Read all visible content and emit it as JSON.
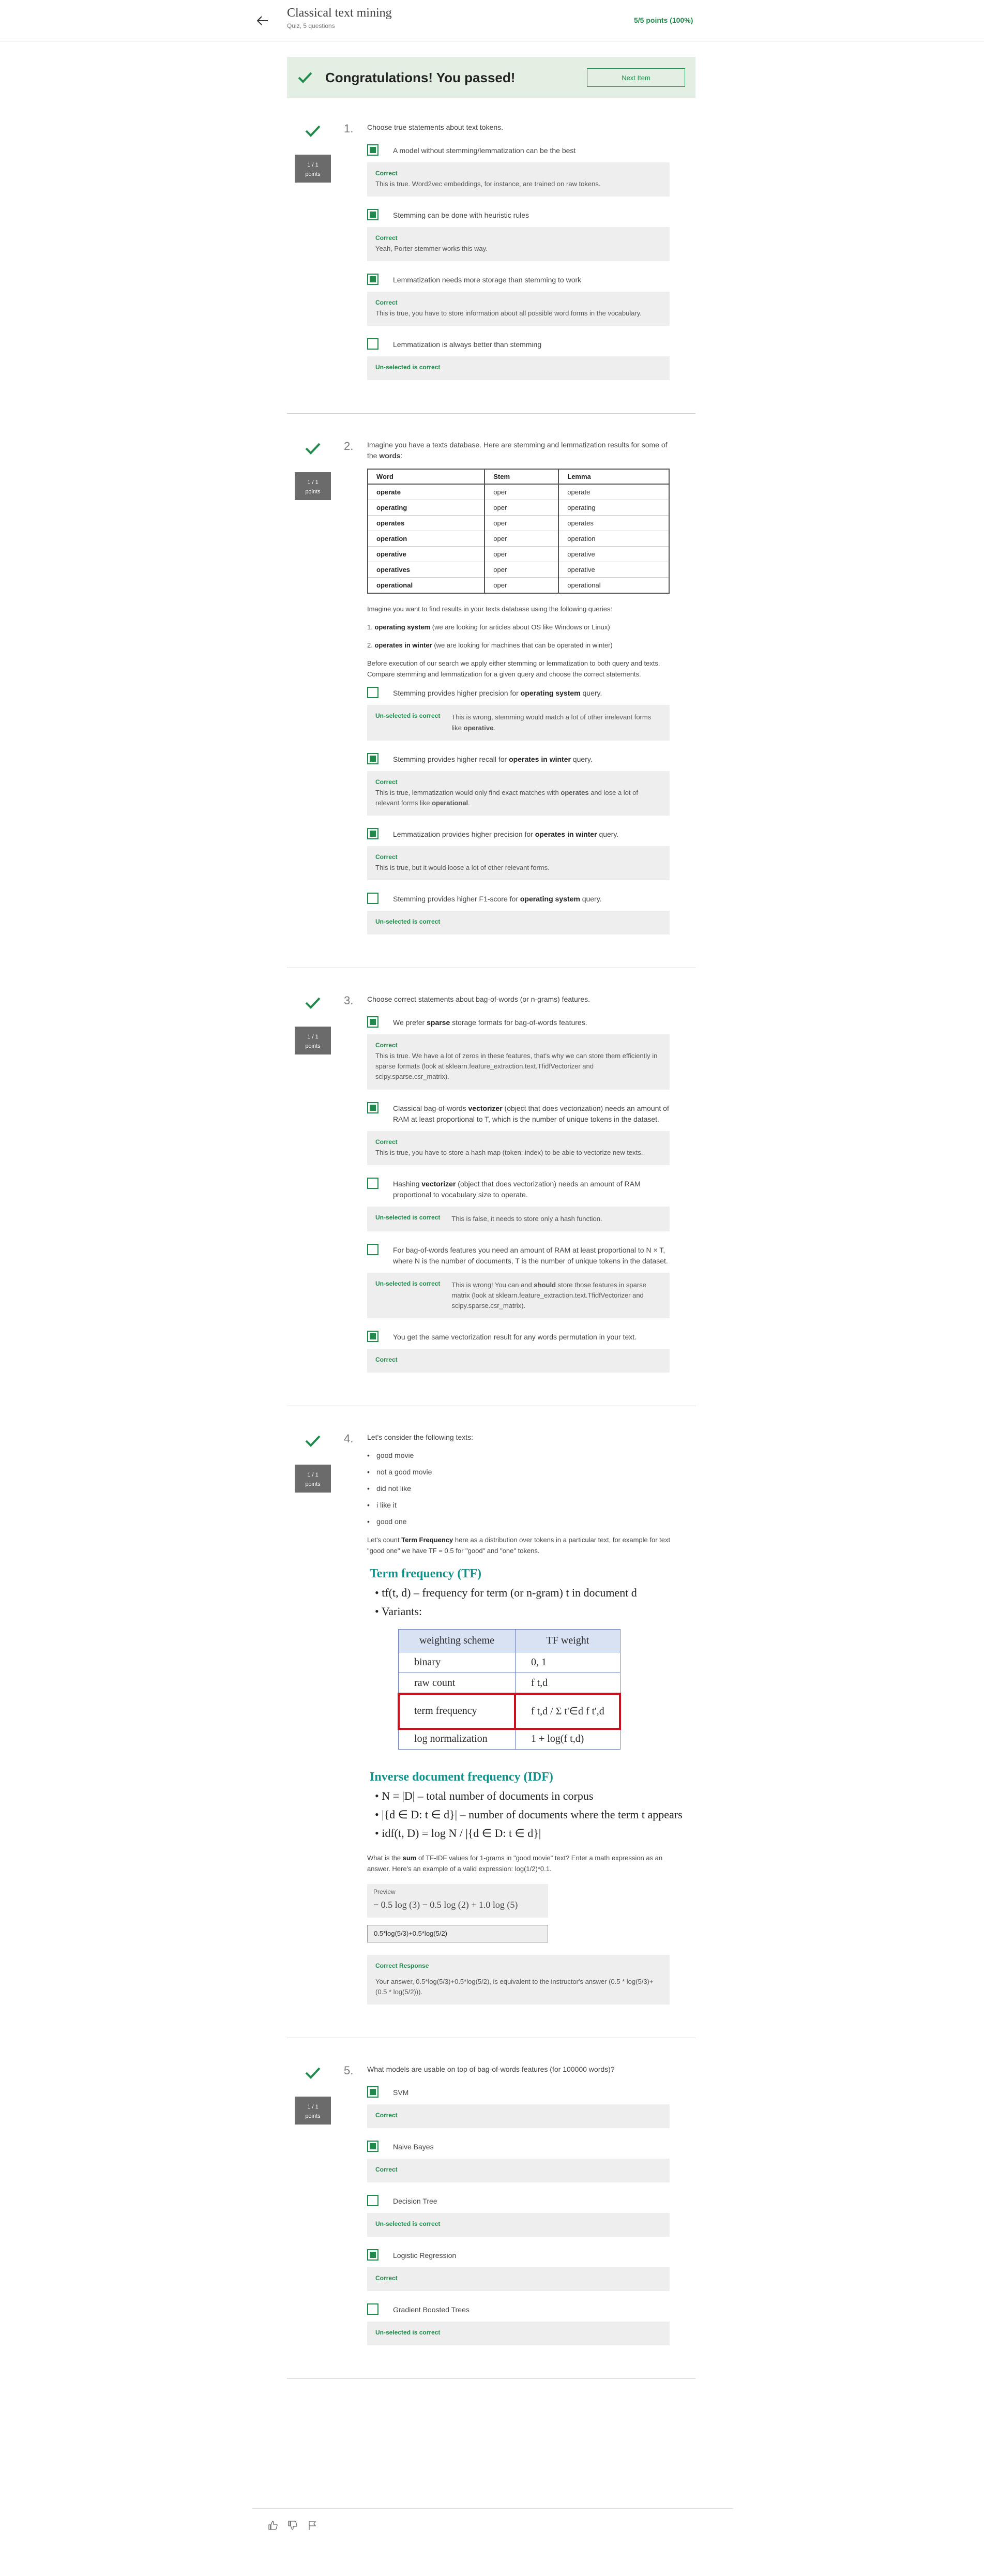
{
  "header": {
    "title": "Classical text mining",
    "subtitle": "Quiz, 5 questions",
    "points": "5/5 points (100%)"
  },
  "banner": {
    "message": "Congratulations! You passed!",
    "next_label": "Next Item"
  },
  "questions": [
    {
      "number": "1.",
      "score": "1 / 1",
      "score_unit": "points",
      "prompt": "Choose true statements about text tokens.",
      "options": [
        {
          "label": "A model without stemming/lemmatization can be the best",
          "checked": true,
          "fb_title": "Correct",
          "fb_text": "This is true. Word2vec embeddings, for instance, are trained on raw tokens."
        },
        {
          "label": "Stemming can be done with heuristic rules",
          "checked": true,
          "fb_title": "Correct",
          "fb_text": "Yeah, Porter stemmer works this way."
        },
        {
          "label": "Lemmatization needs more storage than stemming to work",
          "checked": true,
          "fb_title": "Correct",
          "fb_text": "This is true, you have to store information about all possible word forms in the vocabulary."
        },
        {
          "label": "Lemmatization is always better than stemming",
          "checked": false,
          "fb_title": "Un-selected is correct",
          "fb_text": ""
        }
      ]
    },
    {
      "number": "2.",
      "score": "1 / 1",
      "score_unit": "points",
      "prompt_a": "Imagine you have a texts database. Here are stemming and lemmatization results for some of the",
      "prompt_b": "words",
      "prompt_c": ":",
      "table": {
        "headers": [
          "Word",
          "Stem",
          "Lemma"
        ],
        "rows": [
          [
            "operate",
            "oper",
            "operate"
          ],
          [
            "operating",
            "oper",
            "operating"
          ],
          [
            "operates",
            "oper",
            "operates"
          ],
          [
            "operation",
            "oper",
            "operation"
          ],
          [
            "operative",
            "oper",
            "operative"
          ],
          [
            "operatives",
            "oper",
            "operative"
          ],
          [
            "operational",
            "oper",
            "operational"
          ]
        ]
      },
      "text_queries": "Imagine you want to find results in your texts database using the following queries:",
      "query1_bold": "operating system",
      "query1_rest": " (we are looking for articles about OS like Windows or Linux)",
      "query2_bold": "operates in winter",
      "query2_rest": " (we are looking for machines that can be operated in winter)",
      "text_before": "Before execution of our search we apply either stemming or lemmatization to both query and texts. Compare stemming and lemmatization for a given query and choose the correct statements.",
      "options": [
        {
          "pre": "Stemming provides higher precision for ",
          "bold": "operating system",
          "post": " query.",
          "checked": false,
          "fb_title": "Un-selected is correct",
          "fb_a": "This is wrong, stemming would match a lot of other irrelevant forms like ",
          "fb_b": "operative",
          "fb_c": "."
        },
        {
          "pre": "Stemming provides higher recall for ",
          "bold": "operates in winter",
          "post": " query.",
          "checked": true,
          "fb_title": "Correct",
          "fb_a": "This is true, lemmatization would only find exact matches with ",
          "fb_b": "operates",
          "fb_c": " and lose a lot of relevant forms like ",
          "fb_d": "operational",
          "fb_e": "."
        },
        {
          "pre": "Lemmatization provides higher precision for ",
          "bold": "operates in winter",
          "post": " query.",
          "checked": true,
          "fb_title": "Correct",
          "fb_text": "This is true, but it would loose a lot of other relevant forms."
        },
        {
          "pre": "Stemming provides higher F1-score for ",
          "bold": "operating system",
          "post": " query.",
          "checked": false,
          "fb_title": "Un-selected is correct"
        }
      ]
    },
    {
      "number": "3.",
      "score": "1 / 1",
      "score_unit": "points",
      "prompt": "Choose correct statements about bag-of-words (or n-grams) features.",
      "options": [
        {
          "pre": "We prefer ",
          "bold": "sparse",
          "post": " storage formats for bag-of-words features.",
          "checked": true,
          "fb_title": "Correct",
          "fb_text": "This is true. We have a lot of zeros in these features, that's why we can store them efficiently in sparse formats (look at sklearn.feature_extraction.text.TfidfVectorizer and scipy.sparse.csr_matrix)."
        },
        {
          "pre": "Classical bag-of-words ",
          "bold": "vectorizer",
          "post": " (object that does vectorization) needs an amount of RAM at least proportional to T, which is the number of unique tokens in the dataset.",
          "checked": true,
          "fb_title": "Correct",
          "fb_text": "This is true, you have to store a hash map (token: index) to be able to vectorize new texts."
        },
        {
          "pre": "Hashing ",
          "bold": "vectorizer",
          "post": " (object that does vectorization) needs an amount of RAM proportional to vocabulary size to operate.",
          "checked": false,
          "fb_title": "Un-selected is correct",
          "fb_text": "This is false, it needs to store only a hash function."
        },
        {
          "pre": "For bag-of-words features you need an amount of RAM at least proportional to N × T, where N is the number of documents, T is the number of unique tokens in the dataset.",
          "bold": "",
          "post": "",
          "checked": false,
          "fb_title": "Un-selected is correct",
          "fb_a": "This is wrong! You can and ",
          "fb_b": "should",
          "fb_c": " store those features in sparse matrix (look at sklearn.feature_extraction.text.TfidfVectorizer and scipy.sparse.csr_matrix)."
        },
        {
          "pre": "You get the same vectorization result for any words permutation in your text.",
          "bold": "",
          "post": "",
          "checked": true,
          "fb_title": "Correct",
          "fb_text": ""
        }
      ]
    },
    {
      "number": "4.",
      "score": "1 / 1",
      "score_unit": "points",
      "prompt": "Let's consider the following texts:",
      "texts": [
        "good movie",
        "not a good movie",
        "did not like",
        "i like it",
        "good one"
      ],
      "tf_a": "Let's count ",
      "tf_b": "Term Frequency",
      "tf_c": " here as a distribution over tokens in a particular text, for example for text \"good one\" we have TF = 0.5 for \"good\" and \"one\" tokens.",
      "slide": {
        "tf_heading": "Term frequency (TF)",
        "tf_bullet1": "• tf(t, d) – frequency for term (or n-gram) t in document d",
        "tf_bullet2": "• Variants:",
        "table_headers": [
          "weighting scheme",
          "TF weight"
        ],
        "table_rows": [
          [
            "binary",
            "0, 1"
          ],
          [
            "raw count",
            "f t,d"
          ],
          [
            "term frequency",
            "f t,d / Σ t'∈d f t',d"
          ],
          [
            "log normalization",
            "1 + log(f t,d)"
          ]
        ],
        "idf_heading": "Inverse document frequency (IDF)",
        "idf_b1": "• N = |D| – total number of documents in corpus",
        "idf_b2": "• |{d ∈ D: t ∈ d}| – number of documents where the term t appears",
        "idf_b3": "• idf(t, D) = log N / |{d ∈ D: t ∈ d}|"
      },
      "q_a": "What is the ",
      "q_b": "sum",
      "q_c": " of TF-IDF values for 1-grams in \"good movie\" text? Enter a math expression as an answer. Here's an example of a valid expression: log(1/2)*0.1.",
      "preview_label": "Preview",
      "preview_math": "− 0.5 log (3) − 0.5 log (2) + 1.0 log (5)",
      "answer_value": "0.5*log(5/3)+0.5*log(5/2)",
      "fb_title": "Correct Response",
      "fb_text": "Your answer, 0.5*log(5/3)+0.5*log(5/2), is equivalent to the instructor's answer (0.5 * log(5/3)+(0.5 * log(5/2)))."
    },
    {
      "number": "5.",
      "score": "1 / 1",
      "score_unit": "points",
      "prompt": "What models are usable on top of bag-of-words features (for 100000 words)?",
      "options": [
        {
          "label": "SVM",
          "checked": true,
          "fb_title": "Correct"
        },
        {
          "label": "Naive Bayes",
          "checked": true,
          "fb_title": "Correct"
        },
        {
          "label": "Decision Tree",
          "checked": false,
          "fb_title": "Un-selected is correct"
        },
        {
          "label": "Logistic Regression",
          "checked": true,
          "fb_title": "Correct"
        },
        {
          "label": "Gradient Boosted Trees",
          "checked": false,
          "fb_title": "Un-selected is correct"
        }
      ]
    }
  ],
  "icons": [
    "back-arrow-icon",
    "check-icon",
    "thumbs-up-icon",
    "thumbs-down-icon",
    "flag-icon"
  ],
  "colors": {
    "accent": "#1f8a4c",
    "banner_bg": "#e4efe4",
    "feedback_bg": "#eeeeee",
    "badge": "#6b6b6b",
    "highlight": "#c8101e",
    "slide_heading": "#14908a"
  }
}
